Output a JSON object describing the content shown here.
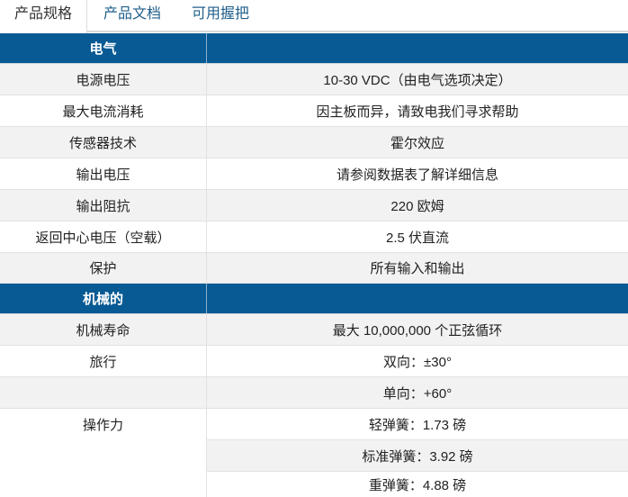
{
  "tabs": [
    "产品规格",
    "产品文档",
    "可用握把"
  ],
  "sections": {
    "electrical": "电气",
    "mechanical": "机械的"
  },
  "electrical_rows": [
    {
      "label": "电源电压",
      "value": "10-30 VDC（由电气选项决定）"
    },
    {
      "label": "最大电流消耗",
      "value": "因主板而异，请致电我们寻求帮助"
    },
    {
      "label": "传感器技术",
      "value": "霍尔效应"
    },
    {
      "label": "输出电压",
      "value": "请参阅数据表了解详细信息"
    },
    {
      "label": "输出阻抗",
      "value": "220 欧姆"
    },
    {
      "label": "返回中心电压（空载）",
      "value": "2.5 伏直流"
    },
    {
      "label": "保护",
      "value": "所有输入和输出"
    }
  ],
  "mechanical_rows": {
    "life": {
      "label": "机械寿命",
      "value": "最大 10,000,000 个正弦循环"
    },
    "travel": {
      "label": "旅行",
      "values": [
        "双向：±30°",
        "单向：+60°"
      ]
    },
    "force": {
      "label": "操作力",
      "values": [
        "轻弹簧：1.73 磅",
        "标准弹簧：3.92 磅",
        "重弹簧：4.88 磅"
      ]
    }
  }
}
